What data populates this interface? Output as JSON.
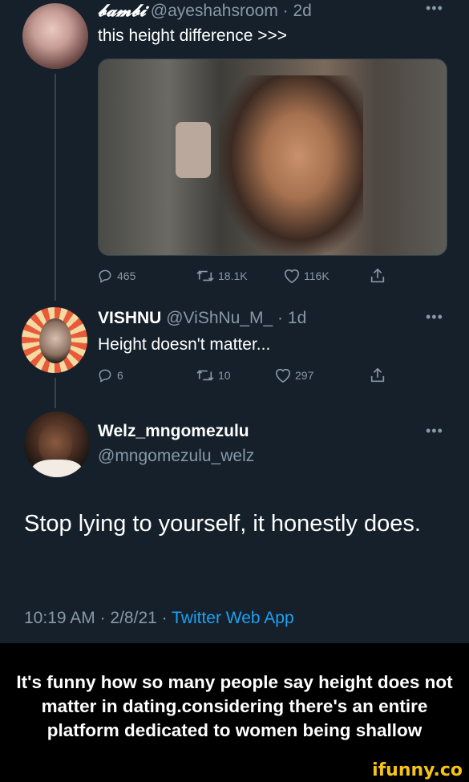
{
  "tweet1": {
    "display_name": "𝓫𝓪𝓶𝓫𝓲",
    "handle": "@ayeshahsroom",
    "time": "2d",
    "text": "this height difference >>>",
    "replies": "465",
    "retweets": "18.1K",
    "likes": "116K"
  },
  "tweet2": {
    "display_name": "VISHNU",
    "handle": "@ViShNu_M_",
    "time": "1d",
    "text": "Height doesn't matter...",
    "replies": "6",
    "retweets": "10",
    "likes": "297"
  },
  "tweet3": {
    "display_name": "Welz_mngomezulu",
    "handle": "@mngomezulu_welz",
    "text": "Stop lying to yourself, it honestly does.",
    "time": "10:19 AM",
    "date": "2/8/21",
    "source": "Twitter Web App"
  },
  "caption": "It's funny how so many people say height does not matter in dating.considering there's an entire platform dedicated to women being shallow",
  "watermark": "ifunny.co",
  "separator": "·",
  "colors": {
    "background": "#15202b",
    "muted": "#8899a6",
    "link": "#1da1f2",
    "watermark": "#f6c416"
  },
  "icons": [
    "reply-icon",
    "retweet-icon",
    "like-icon",
    "share-icon",
    "more-icon"
  ]
}
